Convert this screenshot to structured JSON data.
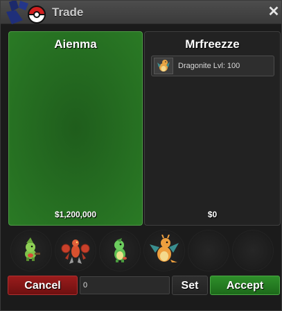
{
  "window": {
    "title": "Trade",
    "close_glyph": "✕",
    "logo_icon": "pokeball-logo-icon"
  },
  "left_panel": {
    "player_name": "Aienma",
    "money": "$1,200,000",
    "color": "#2a7a25"
  },
  "right_panel": {
    "player_name": "Mrfreezze",
    "money": "$0",
    "items": [
      {
        "label": "Dragonite  Lvl: 100",
        "icon": "dragonite-sprite-icon"
      }
    ]
  },
  "party": [
    {
      "icon": "larvitar-sprite-icon"
    },
    {
      "icon": "scizor-sprite-icon"
    },
    {
      "icon": "grass-pokemon-sprite-icon"
    },
    {
      "icon": "dragonite-sprite-icon"
    },
    {
      "icon": "empty-slot"
    },
    {
      "icon": "empty-slot"
    }
  ],
  "actions": {
    "cancel_label": "Cancel",
    "amount_value": "0",
    "set_label": "Set",
    "accept_label": "Accept"
  },
  "colors": {
    "accept": "#2e8f2a",
    "cancel": "#9a1c1c"
  }
}
